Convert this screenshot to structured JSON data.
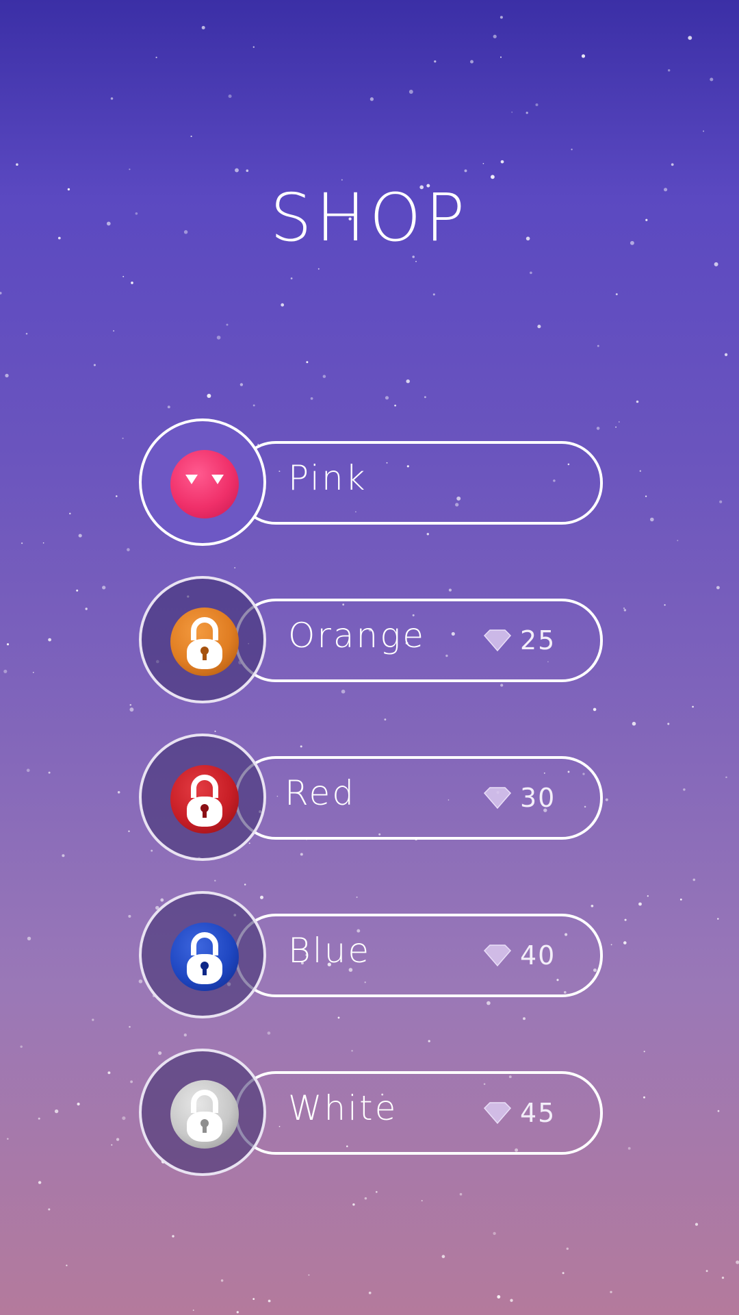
{
  "screen": {
    "title": "SHOP"
  },
  "items": [
    {
      "name": "Pink",
      "locked": false,
      "price": null,
      "color": "#f0306a",
      "color_dark": "#c8184f"
    },
    {
      "name": "Orange",
      "locked": true,
      "price": "25",
      "color": "#e07d22",
      "color_dark": "#a6520e"
    },
    {
      "name": "Red",
      "locked": true,
      "price": "30",
      "color": "#c81e26",
      "color_dark": "#8b0f15"
    },
    {
      "name": "Blue",
      "locked": true,
      "price": "40",
      "color": "#1f47c2",
      "color_dark": "#0e2888"
    },
    {
      "name": "White",
      "locked": true,
      "price": "45",
      "color": "#c8c8c8",
      "color_dark": "#8e8e8e"
    }
  ],
  "icons": {
    "price_icon": "diamond-icon",
    "lock_icon": "padlock-icon"
  },
  "colors": {
    "outline": "#ffffff",
    "diamond": "#d9c8ef"
  }
}
